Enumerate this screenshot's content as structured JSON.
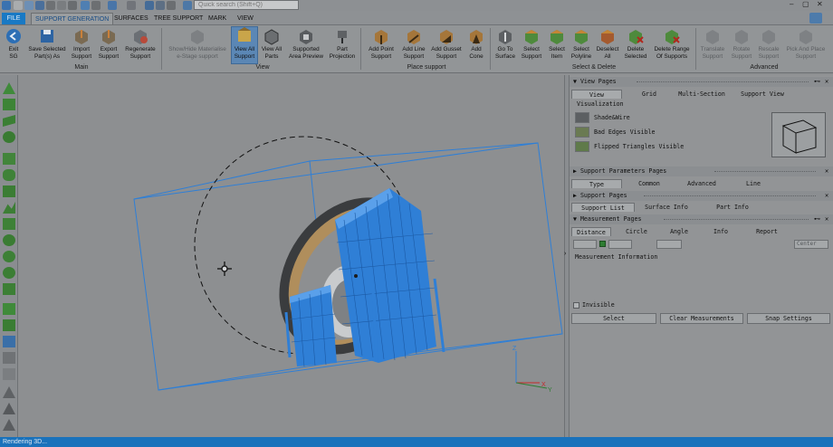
{
  "app": {
    "quick_search_placeholder": "Quick search (Shift+Q)",
    "window_controls": {
      "minimize": "–",
      "maximize": "▢",
      "close": "✕"
    }
  },
  "tabs": [
    {
      "label": "FILE"
    },
    {
      "label": "SUPPORT GENERATION"
    },
    {
      "label": "SURFACES"
    },
    {
      "label": "TREE SUPPORT"
    },
    {
      "label": "MARK"
    },
    {
      "label": "VIEW"
    }
  ],
  "ribbon": {
    "groups": {
      "main": "Main",
      "view": "View",
      "place_support": "Place support",
      "select_delete": "Select & Delete",
      "advanced": "Advanced"
    },
    "buttons": {
      "exit_sg": [
        "Exit",
        "SG"
      ],
      "save_selected": [
        "Save Selected",
        "Part(s) As"
      ],
      "import_support": [
        "Import",
        "Support"
      ],
      "export_support": [
        "Export",
        "Support"
      ],
      "regenerate_support": [
        "Regenerate",
        "Support"
      ],
      "show_hide_materialise": [
        "Show/Hide Materialise",
        "e-Stage support"
      ],
      "view_all_support": [
        "View All",
        "Support"
      ],
      "view_all_parts": [
        "View All",
        "Parts"
      ],
      "supported_area_preview": [
        "Supported",
        "Area Preview"
      ],
      "part_projection": [
        "Part",
        "Projection"
      ],
      "add_point_support": [
        "Add Point",
        "Support"
      ],
      "add_line_support": [
        "Add Line",
        "Support"
      ],
      "add_gusset_support": [
        "Add Gusset",
        "Support"
      ],
      "add_cone": [
        "Add",
        "Cone"
      ],
      "go_to_surface": [
        "Go To",
        "Surface"
      ],
      "select_support": [
        "Select",
        "Support"
      ],
      "select_item": [
        "Select",
        "Item"
      ],
      "select_polyline": [
        "Select",
        "Polyline"
      ],
      "deselect_all": [
        "Deselect",
        "All"
      ],
      "delete_selected": [
        "Delete",
        "Selected"
      ],
      "delete_range": [
        "Delete Range",
        "Of Supports"
      ],
      "translate_support": [
        "Translate",
        "Support"
      ],
      "rotate_support": [
        "Rotate",
        "Support"
      ],
      "rescale_support": [
        "Rescale",
        "Support"
      ],
      "pick_and_place_support": [
        "Pick And Place",
        "Support"
      ]
    }
  },
  "viewport": {
    "axis_z": "Z",
    "axis_x": "X",
    "axis_y": "Y"
  },
  "right_panel": {
    "view_pages": {
      "title": "View Pages",
      "tabs": [
        "View",
        "Grid",
        "Multi-Section",
        "Support View"
      ],
      "visualization_label": "Visualization",
      "options": [
        "Shade&Wire",
        "Bad Edges Visible",
        "Flipped Triangles Visible"
      ]
    },
    "support_parameters_pages": {
      "title": "Support Parameters Pages",
      "tabs": [
        "Type",
        "Common",
        "Advanced",
        "Line"
      ]
    },
    "support_pages": {
      "title": "Support Pages",
      "tabs": [
        "Support List",
        "Surface Info",
        "Part Info"
      ]
    },
    "measurement_pages": {
      "title": "Measurement Pages",
      "tabs": [
        "Distance",
        "Circle",
        "Angle",
        "Info",
        "Report"
      ],
      "center_option": "Center",
      "info_label": "Measurement Information",
      "invisible_label": "Invisible",
      "buttons": [
        "Select",
        "Clear Measurements",
        "Snap Settings"
      ]
    }
  },
  "status": {
    "text": "Rendering 3D..."
  },
  "colors": {
    "accent_blue": "#1979c4",
    "support_blue": "#2f7fd6",
    "wheel_tan": "#b08e5c"
  }
}
